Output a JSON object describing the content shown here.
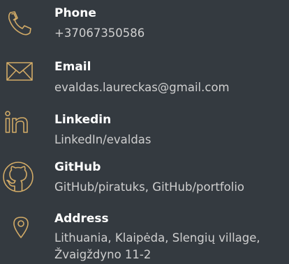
{
  "colors": {
    "background": "#343a40",
    "accent": "#d2ab67",
    "label": "#ffffff",
    "value": "#cfcfcf"
  },
  "contacts": [
    {
      "icon": "phone-icon",
      "label": "Phone",
      "value": "+37067350586"
    },
    {
      "icon": "envelope-icon",
      "label": "Email",
      "value": "evaldas.laureckas@gmail.com"
    },
    {
      "icon": "linkedin-icon",
      "label": "Linkedin",
      "value": "LinkedIn/evaldas"
    },
    {
      "icon": "github-icon",
      "label": "GitHub",
      "links": [
        "GitHub/piratuks",
        "GitHub/portfolio"
      ],
      "separator": ", "
    },
    {
      "icon": "location-pin-icon",
      "label": "Address",
      "value": "Lithuania, Klaipėda, Slengių village, Žvaigždyno 11-2"
    }
  ]
}
